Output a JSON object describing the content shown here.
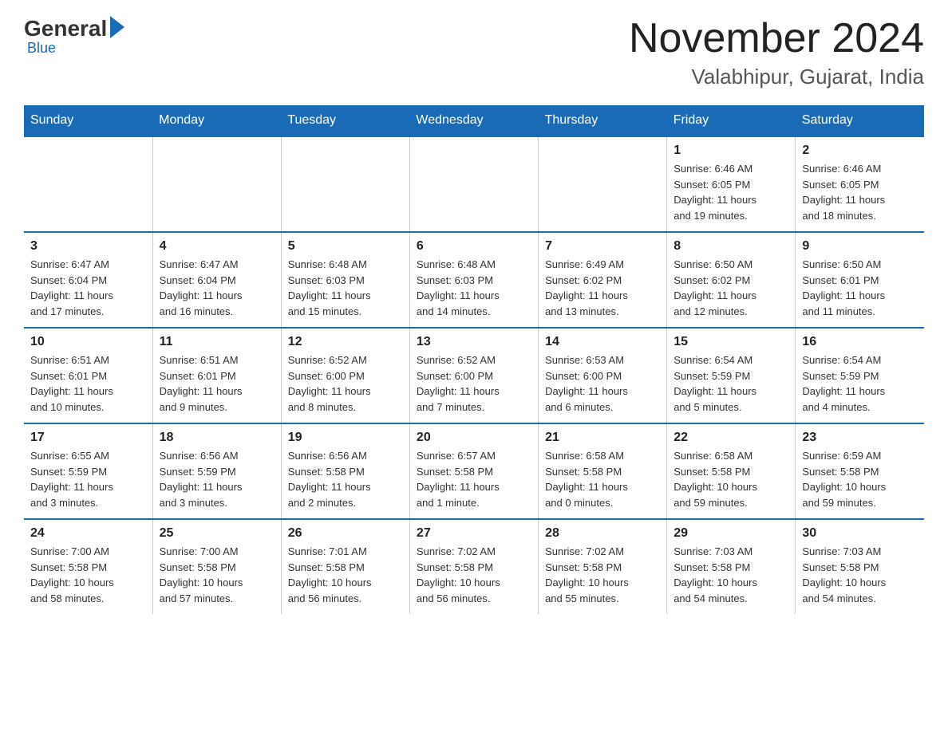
{
  "logo": {
    "general": "General",
    "blue": "Blue"
  },
  "title": "November 2024",
  "subtitle": "Valabhipur, Gujarat, India",
  "days_of_week": [
    "Sunday",
    "Monday",
    "Tuesday",
    "Wednesday",
    "Thursday",
    "Friday",
    "Saturday"
  ],
  "weeks": [
    {
      "cells": [
        {
          "day": "",
          "info": ""
        },
        {
          "day": "",
          "info": ""
        },
        {
          "day": "",
          "info": ""
        },
        {
          "day": "",
          "info": ""
        },
        {
          "day": "",
          "info": ""
        },
        {
          "day": "1",
          "info": "Sunrise: 6:46 AM\nSunset: 6:05 PM\nDaylight: 11 hours\nand 19 minutes."
        },
        {
          "day": "2",
          "info": "Sunrise: 6:46 AM\nSunset: 6:05 PM\nDaylight: 11 hours\nand 18 minutes."
        }
      ]
    },
    {
      "cells": [
        {
          "day": "3",
          "info": "Sunrise: 6:47 AM\nSunset: 6:04 PM\nDaylight: 11 hours\nand 17 minutes."
        },
        {
          "day": "4",
          "info": "Sunrise: 6:47 AM\nSunset: 6:04 PM\nDaylight: 11 hours\nand 16 minutes."
        },
        {
          "day": "5",
          "info": "Sunrise: 6:48 AM\nSunset: 6:03 PM\nDaylight: 11 hours\nand 15 minutes."
        },
        {
          "day": "6",
          "info": "Sunrise: 6:48 AM\nSunset: 6:03 PM\nDaylight: 11 hours\nand 14 minutes."
        },
        {
          "day": "7",
          "info": "Sunrise: 6:49 AM\nSunset: 6:02 PM\nDaylight: 11 hours\nand 13 minutes."
        },
        {
          "day": "8",
          "info": "Sunrise: 6:50 AM\nSunset: 6:02 PM\nDaylight: 11 hours\nand 12 minutes."
        },
        {
          "day": "9",
          "info": "Sunrise: 6:50 AM\nSunset: 6:01 PM\nDaylight: 11 hours\nand 11 minutes."
        }
      ]
    },
    {
      "cells": [
        {
          "day": "10",
          "info": "Sunrise: 6:51 AM\nSunset: 6:01 PM\nDaylight: 11 hours\nand 10 minutes."
        },
        {
          "day": "11",
          "info": "Sunrise: 6:51 AM\nSunset: 6:01 PM\nDaylight: 11 hours\nand 9 minutes."
        },
        {
          "day": "12",
          "info": "Sunrise: 6:52 AM\nSunset: 6:00 PM\nDaylight: 11 hours\nand 8 minutes."
        },
        {
          "day": "13",
          "info": "Sunrise: 6:52 AM\nSunset: 6:00 PM\nDaylight: 11 hours\nand 7 minutes."
        },
        {
          "day": "14",
          "info": "Sunrise: 6:53 AM\nSunset: 6:00 PM\nDaylight: 11 hours\nand 6 minutes."
        },
        {
          "day": "15",
          "info": "Sunrise: 6:54 AM\nSunset: 5:59 PM\nDaylight: 11 hours\nand 5 minutes."
        },
        {
          "day": "16",
          "info": "Sunrise: 6:54 AM\nSunset: 5:59 PM\nDaylight: 11 hours\nand 4 minutes."
        }
      ]
    },
    {
      "cells": [
        {
          "day": "17",
          "info": "Sunrise: 6:55 AM\nSunset: 5:59 PM\nDaylight: 11 hours\nand 3 minutes."
        },
        {
          "day": "18",
          "info": "Sunrise: 6:56 AM\nSunset: 5:59 PM\nDaylight: 11 hours\nand 3 minutes."
        },
        {
          "day": "19",
          "info": "Sunrise: 6:56 AM\nSunset: 5:58 PM\nDaylight: 11 hours\nand 2 minutes."
        },
        {
          "day": "20",
          "info": "Sunrise: 6:57 AM\nSunset: 5:58 PM\nDaylight: 11 hours\nand 1 minute."
        },
        {
          "day": "21",
          "info": "Sunrise: 6:58 AM\nSunset: 5:58 PM\nDaylight: 11 hours\nand 0 minutes."
        },
        {
          "day": "22",
          "info": "Sunrise: 6:58 AM\nSunset: 5:58 PM\nDaylight: 10 hours\nand 59 minutes."
        },
        {
          "day": "23",
          "info": "Sunrise: 6:59 AM\nSunset: 5:58 PM\nDaylight: 10 hours\nand 59 minutes."
        }
      ]
    },
    {
      "cells": [
        {
          "day": "24",
          "info": "Sunrise: 7:00 AM\nSunset: 5:58 PM\nDaylight: 10 hours\nand 58 minutes."
        },
        {
          "day": "25",
          "info": "Sunrise: 7:00 AM\nSunset: 5:58 PM\nDaylight: 10 hours\nand 57 minutes."
        },
        {
          "day": "26",
          "info": "Sunrise: 7:01 AM\nSunset: 5:58 PM\nDaylight: 10 hours\nand 56 minutes."
        },
        {
          "day": "27",
          "info": "Sunrise: 7:02 AM\nSunset: 5:58 PM\nDaylight: 10 hours\nand 56 minutes."
        },
        {
          "day": "28",
          "info": "Sunrise: 7:02 AM\nSunset: 5:58 PM\nDaylight: 10 hours\nand 55 minutes."
        },
        {
          "day": "29",
          "info": "Sunrise: 7:03 AM\nSunset: 5:58 PM\nDaylight: 10 hours\nand 54 minutes."
        },
        {
          "day": "30",
          "info": "Sunrise: 7:03 AM\nSunset: 5:58 PM\nDaylight: 10 hours\nand 54 minutes."
        }
      ]
    }
  ]
}
